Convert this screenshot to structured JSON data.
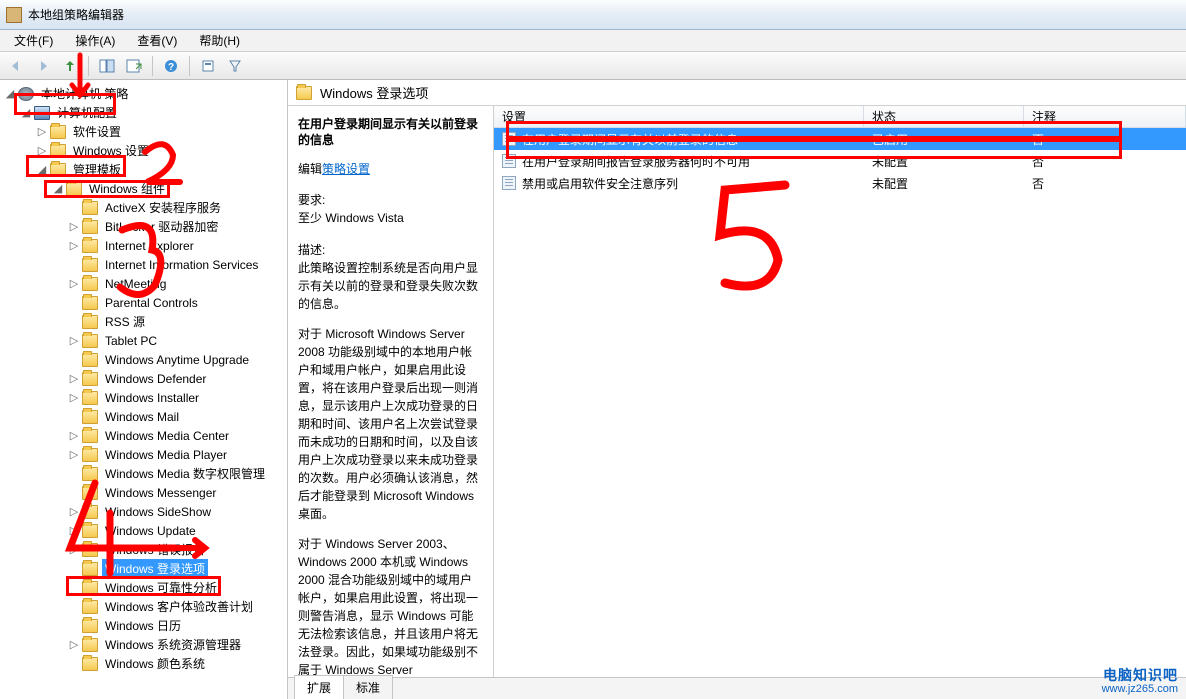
{
  "window": {
    "title": "本地组策略编辑器"
  },
  "menu": {
    "file": "文件(F)",
    "action": "操作(A)",
    "view": "查看(V)",
    "help": "帮助(H)"
  },
  "toolbar_icons": {
    "back": "back-icon",
    "forward": "forward-icon",
    "up": "up-icon",
    "show_hide": "show-hide-tree-icon",
    "export": "export-list-icon",
    "help": "help-icon",
    "properties": "properties-icon",
    "filter": "filter-icon"
  },
  "tree": {
    "root": "本地计算机 策略",
    "computer_config": "计算机配置",
    "children": [
      "软件设置",
      "Windows 设置",
      "管理模板"
    ],
    "admin_templates_children": {
      "windows_components": "Windows 组件",
      "items": [
        "ActiveX 安装程序服务",
        "BitLocker 驱动器加密",
        "Internet Explorer",
        "Internet Information Services",
        "NetMeeting",
        "Parental Controls",
        "RSS 源",
        "Tablet PC",
        "Windows Anytime Upgrade",
        "Windows Defender",
        "Windows Installer",
        "Windows Mail",
        "Windows Media Center",
        "Windows Media Player",
        "Windows Media 数字权限管理",
        "Windows Messenger",
        "Windows SideShow",
        "Windows Update",
        "Windows 错误报告",
        "Windows 登录选项",
        "Windows 可靠性分析",
        "Windows 客户体验改善计划",
        "Windows 日历",
        "Windows 系统资源管理器",
        "Windows 颜色系统"
      ]
    }
  },
  "right": {
    "path_title": "Windows 登录选项",
    "detail": {
      "title": "在用户登录期间显示有关以前登录的信息",
      "edit_prefix": "编辑",
      "edit_link": "策略设置",
      "req_label": "要求:",
      "req_value": "至少 Windows Vista",
      "desc_label": "描述:",
      "desc_p1": "此策略设置控制系统是否向用户显示有关以前的登录和登录失败次数的信息。",
      "desc_p2": "对于 Microsoft Windows Server 2008 功能级别域中的本地用户帐户和域用户帐户，如果启用此设置，将在该用户登录后出现一则消息，显示该用户上次成功登录的日期和时间、该用户名上次尝试登录而未成功的日期和时间，以及自该用户上次成功登录以来未成功登录的次数。用户必须确认该消息，然后才能登录到 Microsoft Windows 桌面。",
      "desc_p3": "对于 Windows Server 2003、Windows 2000 本机或 Windows 2000 混合功能级别域中的域用户帐户，如果启用此设置，将出现一则警告消息，显示 Windows 可能无法检索该信息，并且该用户将无法登录。因此，如果域功能级别不属于 Windows Server"
    },
    "columns": {
      "setting": "设置",
      "state": "状态",
      "comment": "注释"
    },
    "rows": [
      {
        "setting": "在用户登录期间显示有关以前登录的信息",
        "state": "已启用",
        "comment": "否",
        "selected": true
      },
      {
        "setting": "在用户登录期间报告登录服务器何时不可用",
        "state": "未配置",
        "comment": "否",
        "selected": false
      },
      {
        "setting": "禁用或启用软件安全注意序列",
        "state": "未配置",
        "comment": "否",
        "selected": false
      }
    ],
    "tabs": {
      "extended": "扩展",
      "standard": "标准"
    }
  },
  "annotations": {
    "numbers": [
      "2",
      "3",
      "4",
      "5"
    ]
  },
  "watermark": {
    "line1": "电脑知识吧",
    "line2": "www.jz265.com"
  }
}
